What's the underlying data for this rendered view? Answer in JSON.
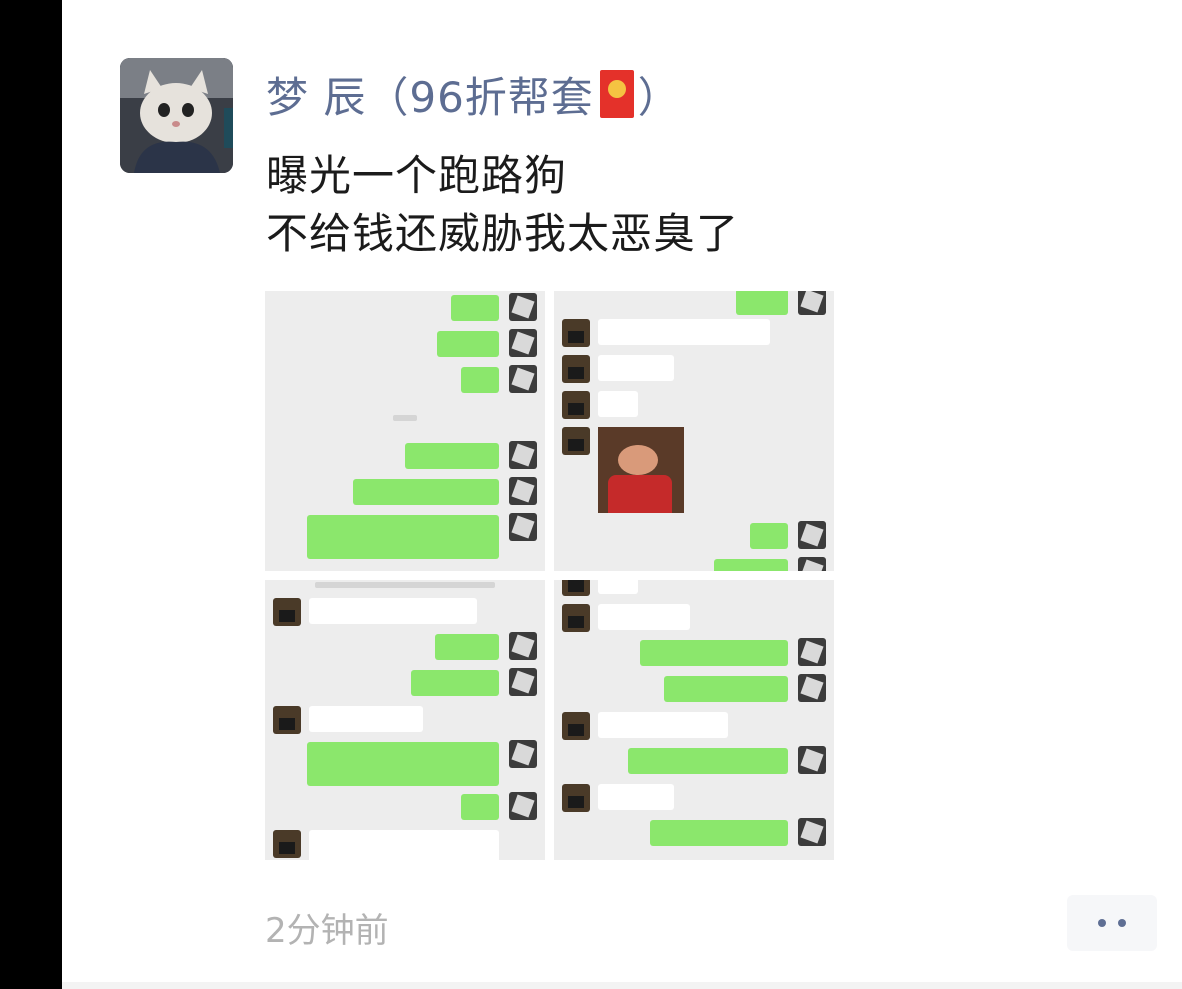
{
  "post": {
    "author_name": "梦 辰（96折帮套",
    "author_close": "）",
    "text_line1": "曝光一个跑路狗",
    "text_line2": "不给钱还威胁我太恶臭了",
    "timestamp": "2分钟前"
  },
  "icons": {
    "more": "more-dots-icon",
    "envelope": "red-envelope-icon"
  },
  "colors": {
    "author": "#5d6d92",
    "text": "#1b1b1b",
    "timestamp": "#b3b3b3",
    "chat_green": "#8be76c",
    "chat_bg": "#ededed"
  }
}
